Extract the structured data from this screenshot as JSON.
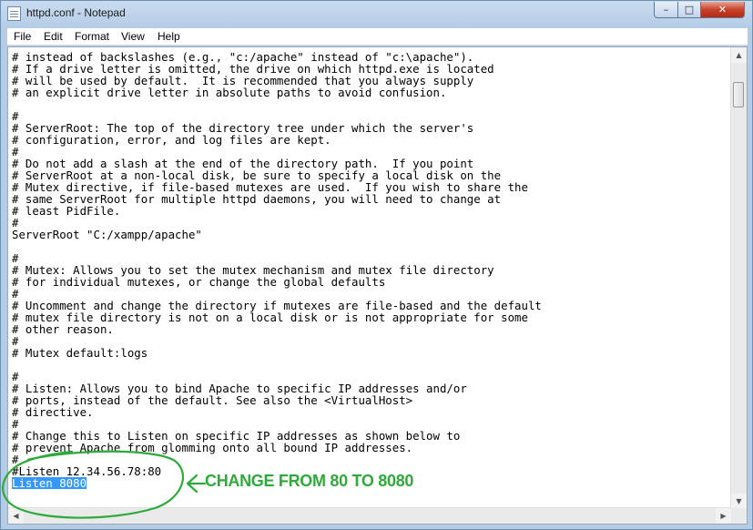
{
  "window": {
    "title": "httpd.conf - Notepad",
    "controls": {
      "minimize": "–",
      "maximize": "□",
      "close": "✕"
    }
  },
  "menu": [
    "File",
    "Edit",
    "Format",
    "View",
    "Help"
  ],
  "icons": {
    "app": "notepad-icon",
    "scroll_up": "▲",
    "scroll_down": "▼",
    "scroll_left": "◀",
    "scroll_right": "▶"
  },
  "editor": {
    "lines": [
      "# instead of backslashes (e.g., \"c:/apache\" instead of \"c:\\apache\").",
      "# If a drive letter is omitted, the drive on which httpd.exe is located",
      "# will be used by default.  It is recommended that you always supply",
      "# an explicit drive letter in absolute paths to avoid confusion.",
      "",
      "#",
      "# ServerRoot: The top of the directory tree under which the server's",
      "# configuration, error, and log files are kept.",
      "#",
      "# Do not add a slash at the end of the directory path.  If you point",
      "# ServerRoot at a non-local disk, be sure to specify a local disk on the",
      "# Mutex directive, if file-based mutexes are used.  If you wish to share the",
      "# same ServerRoot for multiple httpd daemons, you will need to change at",
      "# least PidFile.",
      "#",
      "ServerRoot \"C:/xampp/apache\"",
      "",
      "#",
      "# Mutex: Allows you to set the mutex mechanism and mutex file directory",
      "# for individual mutexes, or change the global defaults",
      "#",
      "# Uncomment and change the directory if mutexes are file-based and the default",
      "# mutex file directory is not on a local disk or is not appropriate for some",
      "# other reason.",
      "#",
      "# Mutex default:logs",
      "",
      "#",
      "# Listen: Allows you to bind Apache to specific IP addresses and/or",
      "# ports, instead of the default. See also the <VirtualHost>",
      "# directive.",
      "#",
      "# Change this to Listen on specific IP addresses as shown below to",
      "# prevent Apache from glomming onto all bound IP addresses.",
      "#",
      "#Listen 12.34.56.78:80",
      "Listen 8080"
    ],
    "selected_line": 36
  },
  "annotation": {
    "text": "CHANGE FROM 80 TO 8080",
    "color": "#2eaa3a"
  }
}
